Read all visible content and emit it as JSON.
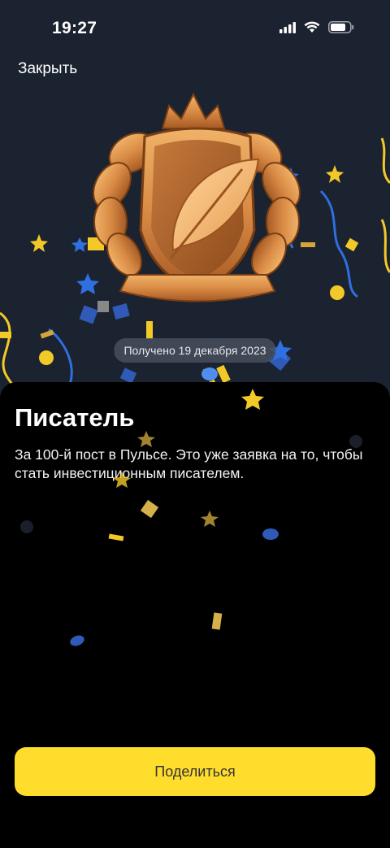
{
  "status_bar": {
    "time": "19:27"
  },
  "header": {
    "close_label": "Закрыть"
  },
  "achievement": {
    "received_date": "Получено 19 декабря 2023",
    "title": "Писатель",
    "description": "За 100-й пост в Пульсе. Это уже заявка на то, чтобы стать инвестиционным писателем."
  },
  "actions": {
    "share_label": "Поделиться"
  },
  "colors": {
    "accent_yellow": "#ffdd2d",
    "background_top": "#1b2230",
    "sheet": "#000000",
    "gold": "#d9924a",
    "confetti_blue": "#2f6fe0"
  }
}
